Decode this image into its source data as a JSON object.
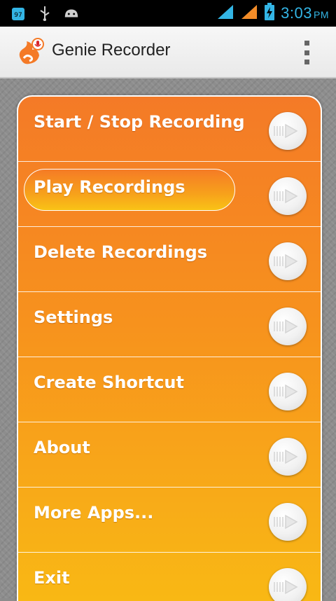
{
  "status_bar": {
    "time": "3:03",
    "ampm": "PM",
    "icons": [
      "notification-badge-icon",
      "usb-icon",
      "android-debug-icon",
      "signal-icon",
      "signal-roaming-icon",
      "battery-charging-icon"
    ],
    "badge_text": "97",
    "accent_color": "#33b5e5",
    "alt_signal_color": "#f28c28"
  },
  "action_bar": {
    "title": "Genie Recorder",
    "logo": "genie-logo-icon",
    "overflow_icon": "overflow-menu-icon"
  },
  "menu": {
    "items": [
      {
        "label": "Start / Stop Recording",
        "selected": false
      },
      {
        "label": "Play Recordings",
        "selected": true
      },
      {
        "label": "Delete Recordings",
        "selected": false
      },
      {
        "label": "Settings",
        "selected": false
      },
      {
        "label": "Create Shortcut",
        "selected": false
      },
      {
        "label": "About",
        "selected": false
      },
      {
        "label": "More Apps...",
        "selected": false
      },
      {
        "label": "Exit",
        "selected": false
      }
    ],
    "arrow_icon": "arrow-right-icon",
    "colors": {
      "top": "#f47a27",
      "bottom": "#f9b814",
      "text": "#ffffff"
    }
  }
}
